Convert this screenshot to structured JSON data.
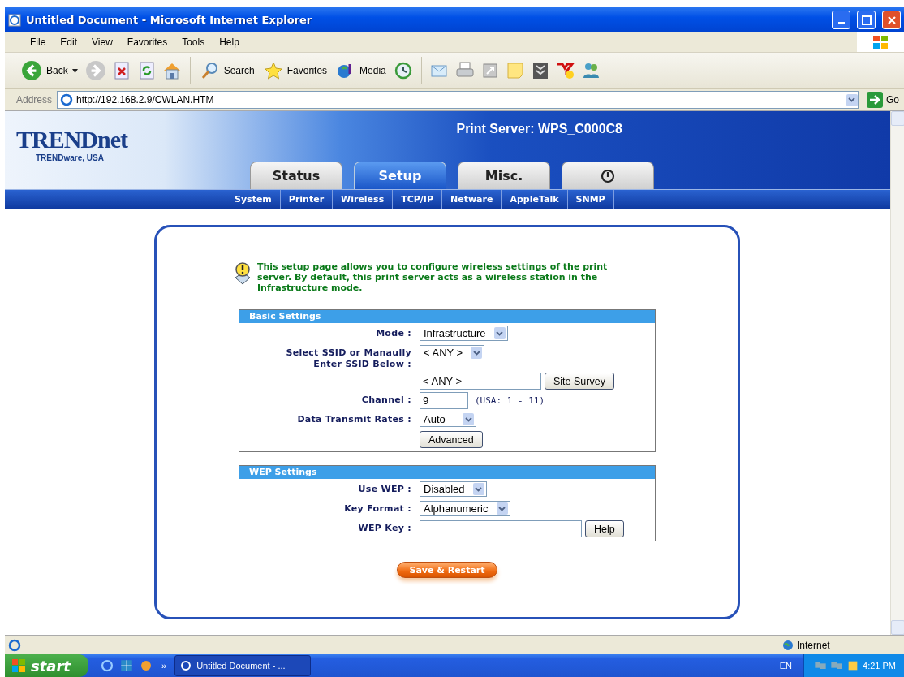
{
  "window": {
    "title": "Untitled Document - Microsoft Internet Explorer"
  },
  "menu": [
    "File",
    "Edit",
    "View",
    "Favorites",
    "Tools",
    "Help"
  ],
  "toolbar": {
    "back": "Back",
    "search": "Search",
    "favorites": "Favorites",
    "media": "Media"
  },
  "address": {
    "label": "Address",
    "url": "http://192.168.2.9/CWLAN.HTM",
    "go": "Go"
  },
  "header": {
    "logo": "TRENDnet",
    "logo_sub": "TRENDware, USA",
    "title": "Print Server: WPS_C000C8"
  },
  "tabs": [
    {
      "kind": "text",
      "label": "Status",
      "selected": false
    },
    {
      "kind": "text",
      "label": "Setup",
      "selected": true
    },
    {
      "kind": "text",
      "label": "Misc.",
      "selected": false
    },
    {
      "kind": "icon",
      "selected": false
    }
  ],
  "subnav": [
    "System",
    "Printer",
    "Wireless",
    "TCP/IP",
    "Netware",
    "AppleTalk",
    "SNMP"
  ],
  "intro": "This setup page allows you to configure wireless settings of the print server. By default, this print server acts as a wireless station in the Infrastructure mode.",
  "sections": [
    {
      "title": "Basic Settings",
      "rows": [
        {
          "label": [
            "Mode :"
          ],
          "controls": [
            {
              "kind": "select",
              "value": "Infrastructure"
            }
          ]
        },
        {
          "label": [
            "Select SSID or Manaully",
            "Enter SSID Below :"
          ],
          "controls": [
            {
              "kind": "select",
              "value": "< ANY >"
            }
          ]
        },
        {
          "controls": [
            {
              "kind": "input",
              "value": "< ANY >"
            },
            {
              "kind": "button",
              "label": "Site Survey"
            }
          ]
        },
        {
          "label": [
            "Channel :"
          ],
          "controls": [
            {
              "kind": "input",
              "value": "9"
            },
            {
              "kind": "note",
              "text": "(USA: 1 - 11)"
            }
          ]
        },
        {
          "label": [
            "Data Transmit Rates :"
          ],
          "controls": [
            {
              "kind": "select",
              "value": "Auto"
            }
          ]
        },
        {
          "controls": [
            {
              "kind": "button",
              "label": "Advanced"
            }
          ]
        }
      ]
    },
    {
      "title": "WEP Settings",
      "rows": [
        {
          "label": [
            "Use WEP :"
          ],
          "controls": [
            {
              "kind": "select",
              "value": "Disabled"
            }
          ]
        },
        {
          "label": [
            "Key Format :"
          ],
          "controls": [
            {
              "kind": "select",
              "value": "Alphanumeric"
            }
          ]
        },
        {
          "label": [
            "WEP Key :"
          ],
          "controls": [
            {
              "kind": "input"
            },
            {
              "kind": "button",
              "label": "Help"
            }
          ]
        }
      ]
    }
  ],
  "save": "Save & Restart",
  "status_bar": {
    "zone": "Internet"
  },
  "taskbar": {
    "start": "start",
    "more": "»",
    "task": "Untitled Document - ...",
    "lang": "EN",
    "time": "4:21 PM"
  }
}
